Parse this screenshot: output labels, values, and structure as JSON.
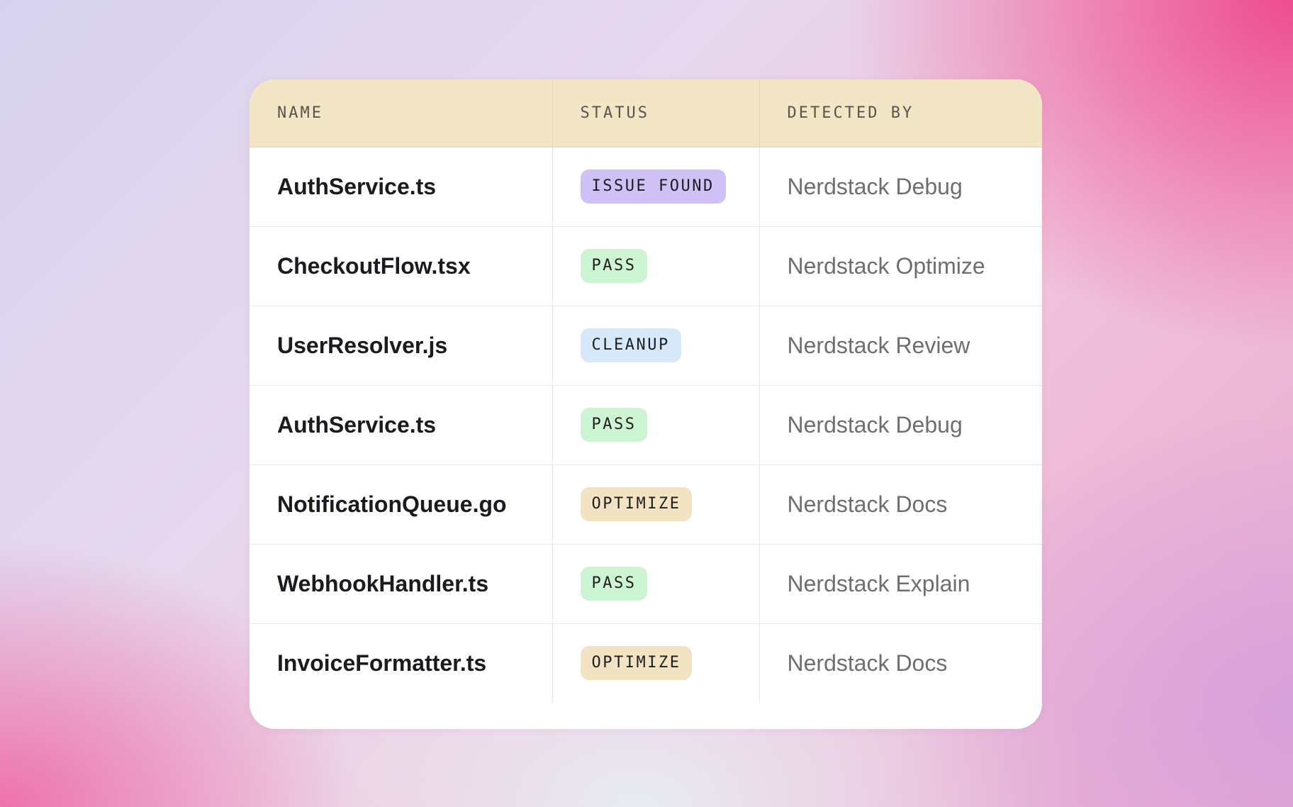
{
  "table": {
    "headers": {
      "name": "NAME",
      "status": "STATUS",
      "detected_by": "DETECTED BY"
    },
    "rows": [
      {
        "name": "AuthService.ts",
        "status": "ISSUE FOUND",
        "status_type": "issue",
        "detected_by": "Nerdstack Debug"
      },
      {
        "name": "CheckoutFlow.tsx",
        "status": "PASS",
        "status_type": "pass",
        "detected_by": "Nerdstack Optimize"
      },
      {
        "name": "UserResolver.js",
        "status": "CLEANUP",
        "status_type": "cleanup",
        "detected_by": "Nerdstack Review"
      },
      {
        "name": "AuthService.ts",
        "status": "PASS",
        "status_type": "pass",
        "detected_by": "Nerdstack Debug"
      },
      {
        "name": "NotificationQueue.go",
        "status": "OPTIMIZE",
        "status_type": "optimize",
        "detected_by": "Nerdstack Docs"
      },
      {
        "name": "WebhookHandler.ts",
        "status": "PASS",
        "status_type": "pass",
        "detected_by": "Nerdstack Explain"
      },
      {
        "name": "InvoiceFormatter.ts",
        "status": "OPTIMIZE",
        "status_type": "optimize",
        "detected_by": "Nerdstack Docs"
      }
    ]
  },
  "colors": {
    "header_bg": "#f3e6c6",
    "issue_found": "#cfc0f5",
    "pass": "#cdf5d3",
    "cleanup": "#d6e8fa",
    "optimize": "#f2e3c2"
  }
}
